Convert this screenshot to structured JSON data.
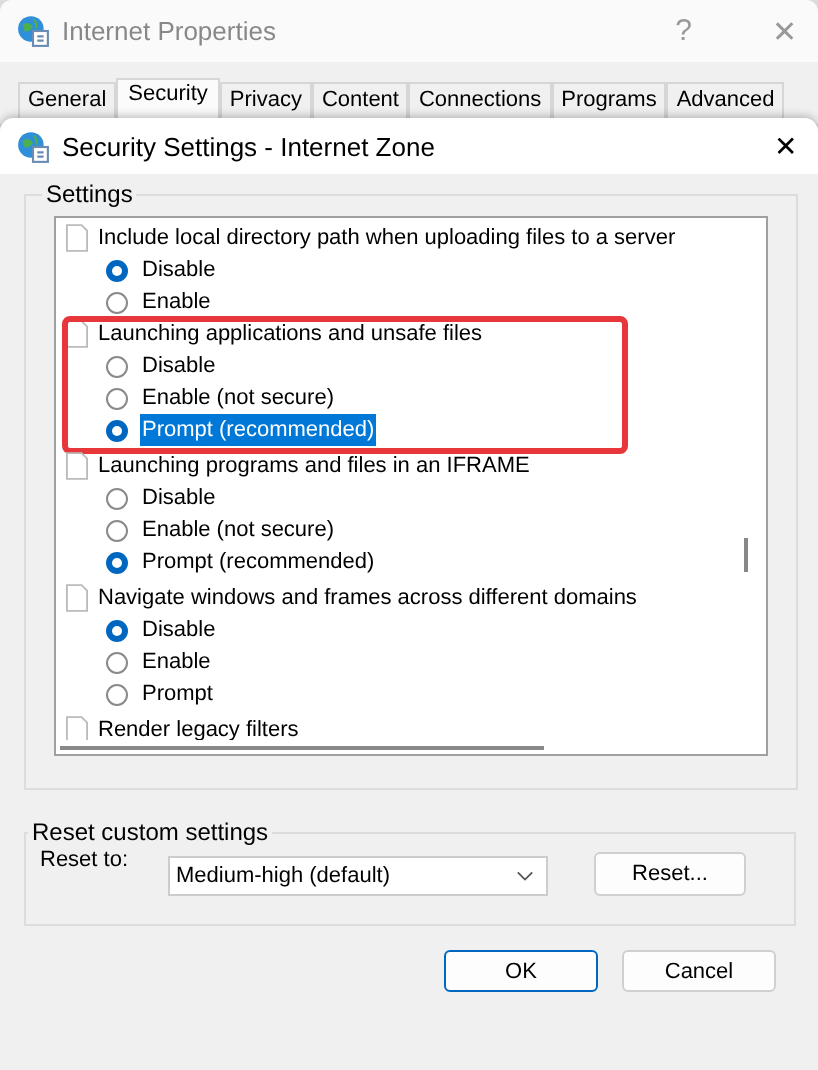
{
  "background_window": {
    "title": "Internet Properties",
    "help": "?",
    "close": "✕",
    "tabs": [
      {
        "label": "General",
        "selected": false
      },
      {
        "label": "Security",
        "selected": true
      },
      {
        "label": "Privacy",
        "selected": false
      },
      {
        "label": "Content",
        "selected": false
      },
      {
        "label": "Connections",
        "selected": false
      },
      {
        "label": "Programs",
        "selected": false
      },
      {
        "label": "Advanced",
        "selected": false
      }
    ]
  },
  "dialog": {
    "title": "Security Settings - Internet Zone",
    "close": "✕",
    "settings": {
      "label": "Settings",
      "items": [
        {
          "title": "Include local directory path when uploading files to a server",
          "options": [
            {
              "label": "Disable",
              "selected": true
            },
            {
              "label": "Enable",
              "selected": false
            }
          ]
        },
        {
          "title": "Launching applications and unsafe files",
          "highlighted": true,
          "options": [
            {
              "label": "Disable",
              "selected": false
            },
            {
              "label": "Enable (not secure)",
              "selected": false
            },
            {
              "label": "Prompt (recommended)",
              "selected": true
            }
          ]
        },
        {
          "title": "Launching programs and files in an IFRAME",
          "options": [
            {
              "label": "Disable",
              "selected": false
            },
            {
              "label": "Enable (not secure)",
              "selected": false
            },
            {
              "label": "Prompt (recommended)",
              "selected": true
            }
          ]
        },
        {
          "title": "Navigate windows and frames across different domains",
          "options": [
            {
              "label": "Disable",
              "selected": true
            },
            {
              "label": "Enable",
              "selected": false
            },
            {
              "label": "Prompt",
              "selected": false
            }
          ]
        },
        {
          "title": "Render legacy filters"
        }
      ]
    },
    "reset": {
      "label": "Reset custom settings",
      "reset_to_label": "Reset to:",
      "value": "Medium-high (default)",
      "button": "Reset..."
    },
    "buttons": [
      "OK",
      "Cancel"
    ]
  }
}
